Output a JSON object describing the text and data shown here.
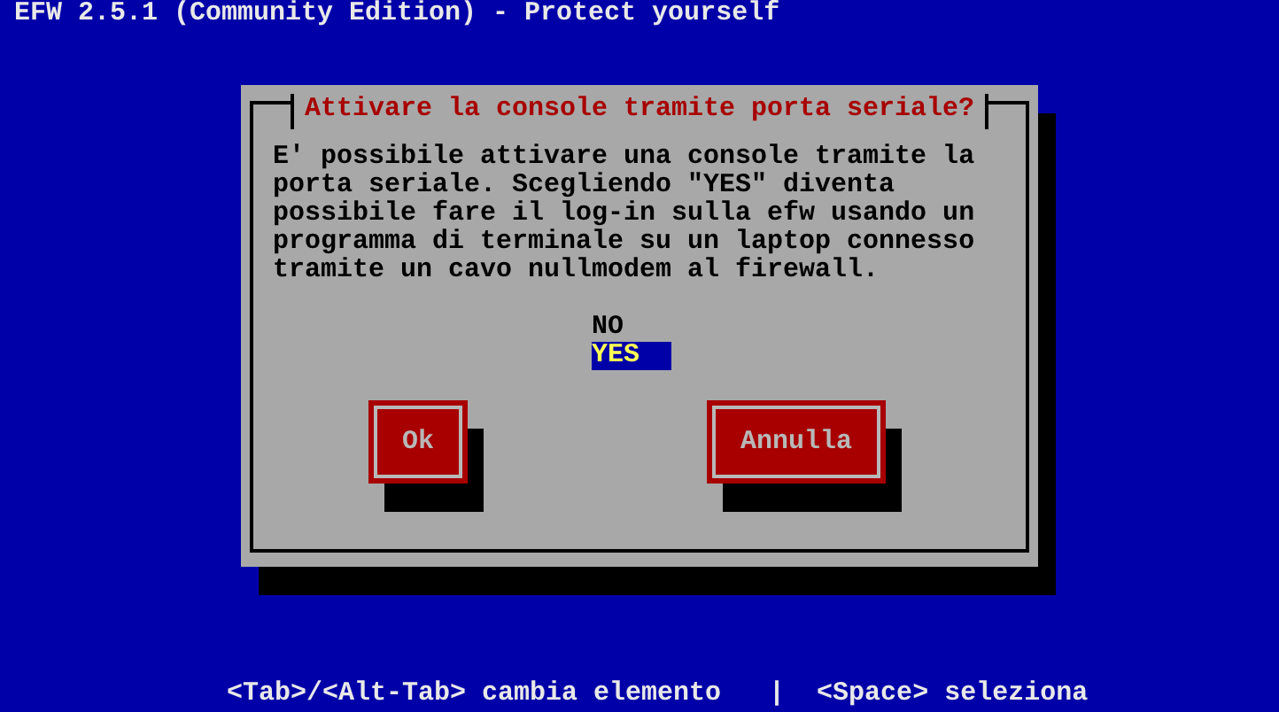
{
  "screen_title": "EFW 2.5.1 (Community Edition) - Protect yourself",
  "dialog": {
    "title": "Attivare la console tramite porta seriale?",
    "message": "E' possibile attivare una console tramite la\nporta seriale. Scegliendo \"YES\" diventa\npossibile fare il log-in sulla efw usando un\nprogramma di terminale su un laptop connesso\ntramite un cavo nullmodem al firewall.",
    "options": [
      {
        "label": "NO",
        "selected": false
      },
      {
        "label": "YES",
        "selected": true
      }
    ],
    "buttons": [
      "Ok",
      "Annulla"
    ]
  },
  "help_line": "<Tab>/<Alt-Tab> cambia elemento   |  <Space> seleziona"
}
